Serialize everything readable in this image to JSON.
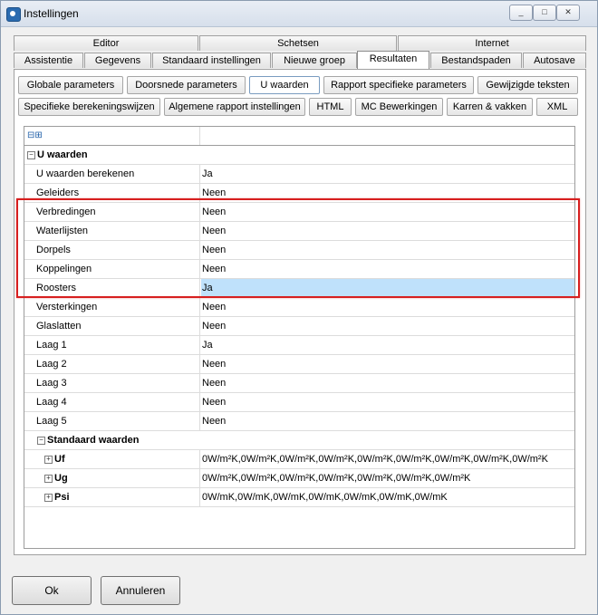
{
  "window": {
    "title": "Instellingen",
    "controls": {
      "minimize": "_",
      "maximize": "□",
      "close": "✕"
    }
  },
  "tabs_top": [
    "Editor",
    "Schetsen",
    "Internet"
  ],
  "tabs_bottom": [
    "Assistentie",
    "Gegevens",
    "Standaard instellingen",
    "Nieuwe groep",
    "Resultaten",
    "Bestandspaden",
    "Autosave"
  ],
  "active_tab": "Resultaten",
  "subtabs_row1": [
    "Globale parameters",
    "Doorsnede parameters",
    "U waarden",
    "Rapport specifieke parameters",
    "Gewijzigde teksten"
  ],
  "subtabs_row2": [
    "Specifieke berekeningswijzen",
    "Algemene rapport instellingen",
    "HTML",
    "MC Bewerkingen",
    "Karren & vakken",
    "XML"
  ],
  "active_subtab": "U waarden",
  "grid": {
    "header_expand": "⊟⊞",
    "category_u": "U waarden",
    "rows": [
      {
        "name": "U waarden berekenen",
        "value": "Ja"
      },
      {
        "name": "Geleiders",
        "value": "Neen"
      },
      {
        "name": "Verbredingen",
        "value": "Neen"
      },
      {
        "name": "Waterlijsten",
        "value": "Neen"
      },
      {
        "name": "Dorpels",
        "value": "Neen"
      },
      {
        "name": "Koppelingen",
        "value": "Neen"
      },
      {
        "name": "Roosters",
        "value": "Ja"
      },
      {
        "name": "Versterkingen",
        "value": "Neen"
      },
      {
        "name": "Glaslatten",
        "value": "Neen"
      },
      {
        "name": "Laag 1",
        "value": "Ja"
      },
      {
        "name": "Laag 2",
        "value": "Neen"
      },
      {
        "name": "Laag 3",
        "value": "Neen"
      },
      {
        "name": "Laag 4",
        "value": "Neen"
      },
      {
        "name": "Laag 5",
        "value": "Neen"
      }
    ],
    "category_std": "Standaard waarden",
    "std_rows": [
      {
        "name": "Uf",
        "value": "0W/m²K,0W/m²K,0W/m²K,0W/m²K,0W/m²K,0W/m²K,0W/m²K,0W/m²K,0W/m²K"
      },
      {
        "name": "Ug",
        "value": "0W/m²K,0W/m²K,0W/m²K,0W/m²K,0W/m²K,0W/m²K,0W/m²K"
      },
      {
        "name": "Psi",
        "value": "0W/mK,0W/mK,0W/mK,0W/mK,0W/mK,0W/mK,0W/mK"
      }
    ]
  },
  "buttons": {
    "ok": "Ok",
    "cancel": "Annuleren"
  },
  "colors": {
    "selection": "#bfe1fb",
    "highlight_border": "#d71f1f"
  }
}
